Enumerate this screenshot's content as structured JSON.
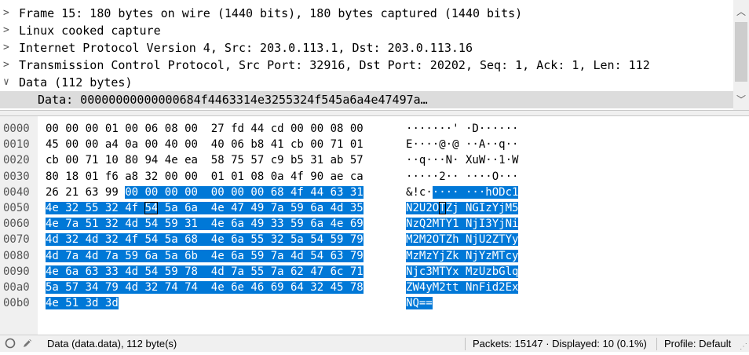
{
  "detail_tree": {
    "rows": [
      {
        "arrow": ">",
        "text": "Frame 15: 180 bytes on wire (1440 bits), 180 bytes captured (1440 bits)",
        "expanded": false
      },
      {
        "arrow": ">",
        "text": "Linux cooked capture",
        "expanded": false
      },
      {
        "arrow": ">",
        "text": "Internet Protocol Version 4, Src: 203.0.113.1, Dst: 203.0.113.16",
        "expanded": false
      },
      {
        "arrow": ">",
        "text": "Transmission Control Protocol, Src Port: 32916, Dst Port: 20202, Seq: 1, Ack: 1, Len: 112",
        "expanded": false
      },
      {
        "arrow": "∨",
        "text": "Data (112 bytes)",
        "expanded": true
      }
    ],
    "selected_child": "Data: 00000000000000684f4463314e3255324f545a6a4e47497a…"
  },
  "bytes_pane": {
    "rows": [
      {
        "offset": "0000",
        "hex": [
          "00",
          "00",
          "00",
          "01",
          "00",
          "06",
          "08",
          "00",
          "27",
          "fd",
          "44",
          "cd",
          "00",
          "00",
          "08",
          "00"
        ],
        "ascii": "·······'·D····"
      },
      {
        "offset": "0010",
        "hex": [
          "45",
          "00",
          "00",
          "a4",
          "0a",
          "00",
          "40",
          "00",
          "40",
          "06",
          "b8",
          "41",
          "cb",
          "00",
          "71",
          "01"
        ],
        "ascii": "E····@·@··A··q·"
      },
      {
        "offset": "0020",
        "hex": [
          "cb",
          "00",
          "71",
          "10",
          "80",
          "94",
          "4e",
          "ea",
          "58",
          "75",
          "57",
          "c9",
          "b5",
          "31",
          "ab",
          "57"
        ],
        "ascii": "··q···N·XuW··1·W"
      },
      {
        "offset": "0030",
        "hex": [
          "80",
          "18",
          "01",
          "f6",
          "a8",
          "32",
          "00",
          "00",
          "01",
          "01",
          "08",
          "0a",
          "4f",
          "90",
          "ae",
          "ca"
        ],
        "ascii": "·····2······O···"
      },
      {
        "offset": "0040",
        "hex": [
          "26",
          "21",
          "63",
          "99",
          "00",
          "00",
          "00",
          "00",
          "00",
          "00",
          "00",
          "68",
          "4f",
          "44",
          "63",
          "31"
        ],
        "ascii": "&!c········hODc1"
      },
      {
        "offset": "0050",
        "hex": [
          "4e",
          "32",
          "55",
          "32",
          "4f",
          "54",
          "5a",
          "6a",
          "4e",
          "47",
          "49",
          "7a",
          "59",
          "6a",
          "4d",
          "35"
        ],
        "ascii": "N2U2OTZjNGIzYjM5"
      },
      {
        "offset": "0060",
        "hex": [
          "4e",
          "7a",
          "51",
          "32",
          "4d",
          "54",
          "59",
          "31",
          "4e",
          "6a",
          "49",
          "33",
          "59",
          "6a",
          "4e",
          "69"
        ],
        "ascii": "NzQ2MTY1NjI3YjNi"
      },
      {
        "offset": "0070",
        "hex": [
          "4d",
          "32",
          "4d",
          "32",
          "4f",
          "54",
          "5a",
          "68",
          "4e",
          "6a",
          "55",
          "32",
          "5a",
          "54",
          "59",
          "79"
        ],
        "ascii": "M2M2OTZhNjU2ZTYy"
      },
      {
        "offset": "0080",
        "hex": [
          "4d",
          "7a",
          "4d",
          "7a",
          "59",
          "6a",
          "5a",
          "6b",
          "4e",
          "6a",
          "59",
          "7a",
          "4d",
          "54",
          "63",
          "79"
        ],
        "ascii": "MzMzYjZkNjYzMTcy"
      },
      {
        "offset": "0090",
        "hex": [
          "4e",
          "6a",
          "63",
          "33",
          "4d",
          "54",
          "59",
          "78",
          "4d",
          "7a",
          "55",
          "7a",
          "62",
          "47",
          "6c",
          "71"
        ],
        "ascii": "Njc3MTYxMzUzbGlq"
      },
      {
        "offset": "00a0",
        "hex": [
          "5a",
          "57",
          "34",
          "79",
          "4d",
          "32",
          "74",
          "74",
          "4e",
          "6e",
          "46",
          "69",
          "64",
          "32",
          "45",
          "78"
        ],
        "ascii": "ZW4yM2ttNnFid2Ex"
      },
      {
        "offset": "00b0",
        "hex": [
          "4e",
          "51",
          "3d",
          "3d"
        ],
        "ascii": "NQ=="
      }
    ]
  },
  "status_bar": {
    "left_text": "Data (data.data), 112 byte(s)",
    "packets_text": "Packets: 15147 · Displayed: 10 (0.1%)",
    "profile_text": "Profile: Default"
  },
  "colors": {
    "selection": "#0078d7",
    "panel_gray": "#f0f0f0"
  }
}
